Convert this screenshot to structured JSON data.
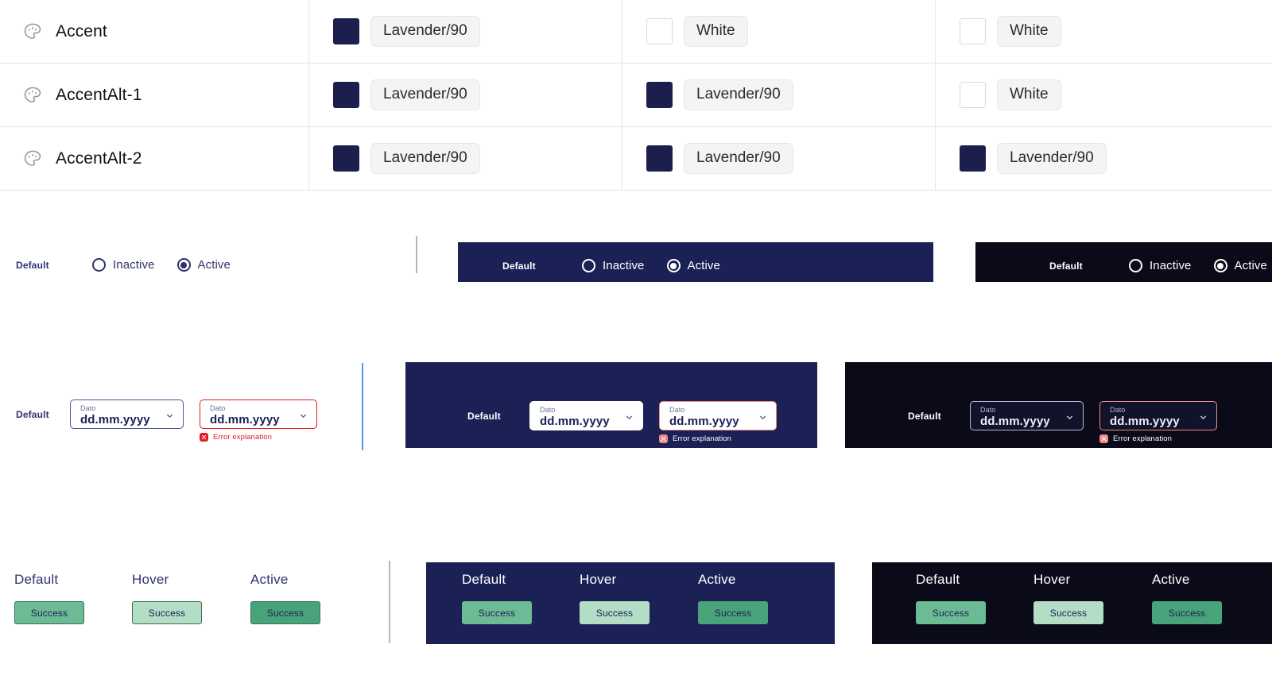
{
  "tokens": {
    "icon_name": "palette-icon",
    "rows": [
      {
        "name": "Accent",
        "cells": [
          {
            "swatch": "navy",
            "label": "Lavender/90"
          },
          {
            "swatch": "white",
            "label": "White"
          },
          {
            "swatch": "white",
            "label": "White"
          }
        ]
      },
      {
        "name": "AccentAlt-1",
        "cells": [
          {
            "swatch": "navy",
            "label": "Lavender/90"
          },
          {
            "swatch": "navy",
            "label": "Lavender/90"
          },
          {
            "swatch": "white",
            "label": "White"
          }
        ]
      },
      {
        "name": "AccentAlt-2",
        "cells": [
          {
            "swatch": "navy",
            "label": "Lavender/90"
          },
          {
            "swatch": "navy",
            "label": "Lavender/90"
          },
          {
            "swatch": "navy",
            "label": "Lavender/90"
          }
        ]
      }
    ]
  },
  "radios": {
    "light": {
      "state": "Default",
      "inactive": "Inactive",
      "active": "Active"
    },
    "navy": {
      "state": "Default",
      "inactive": "Inactive",
      "active": "Active"
    },
    "black": {
      "state": "Default",
      "inactive": "Inactive",
      "active": "Active"
    }
  },
  "dates": {
    "light": {
      "state": "Default",
      "caption": "Dato",
      "value": "dd.mm.yyyy",
      "error_caption": "Dato",
      "error_value": "dd.mm.yyyy",
      "error_message": "Error explanation"
    },
    "navy": {
      "state": "Default",
      "caption": "Dato",
      "value": "dd.mm.yyyy",
      "error_caption": "Dato",
      "error_value": "dd.mm.yyyy",
      "error_message": "Error explanation"
    },
    "black": {
      "state": "Default",
      "caption": "Dato",
      "value": "dd.mm.yyyy",
      "error_caption": "Dato",
      "error_value": "dd.mm.yyyy",
      "error_message": "Error explanation"
    }
  },
  "buttons": {
    "light": {
      "default_head": "Default",
      "hover_head": "Hover",
      "active_head": "Active",
      "default_label": "Success",
      "hover_label": "Success",
      "active_label": "Success"
    },
    "navy": {
      "default_head": "Default",
      "hover_head": "Hover",
      "active_head": "Active",
      "default_label": "Success",
      "hover_label": "Success",
      "active_label": "Success"
    },
    "black": {
      "default_head": "Default",
      "hover_head": "Hover",
      "active_head": "Active",
      "default_label": "Success",
      "hover_label": "Success",
      "active_label": "Success"
    }
  },
  "colors": {
    "navy_swatch": "#1c1f4e",
    "navy_surface": "#1c2155",
    "black_surface": "#0a0a18",
    "accent_blue_divider": "#4a9af5",
    "gray_divider": "#b6b4c6",
    "error_red": "#e01b22",
    "error_salmon": "#f08c86",
    "success_default": "#6cbb94",
    "success_hover": "#b4ddc6",
    "success_active": "#49a37a"
  }
}
